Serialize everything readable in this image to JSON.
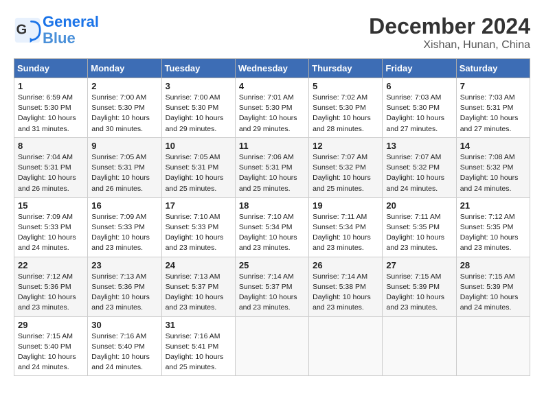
{
  "header": {
    "logo_line1": "General",
    "logo_line2": "Blue",
    "title": "December 2024",
    "location": "Xishan, Hunan, China"
  },
  "days_of_week": [
    "Sunday",
    "Monday",
    "Tuesday",
    "Wednesday",
    "Thursday",
    "Friday",
    "Saturday"
  ],
  "weeks": [
    [
      {
        "day": "1",
        "sunrise": "6:59 AM",
        "sunset": "5:30 PM",
        "daylight": "10 hours and 31 minutes."
      },
      {
        "day": "2",
        "sunrise": "7:00 AM",
        "sunset": "5:30 PM",
        "daylight": "10 hours and 30 minutes."
      },
      {
        "day": "3",
        "sunrise": "7:00 AM",
        "sunset": "5:30 PM",
        "daylight": "10 hours and 29 minutes."
      },
      {
        "day": "4",
        "sunrise": "7:01 AM",
        "sunset": "5:30 PM",
        "daylight": "10 hours and 29 minutes."
      },
      {
        "day": "5",
        "sunrise": "7:02 AM",
        "sunset": "5:30 PM",
        "daylight": "10 hours and 28 minutes."
      },
      {
        "day": "6",
        "sunrise": "7:03 AM",
        "sunset": "5:30 PM",
        "daylight": "10 hours and 27 minutes."
      },
      {
        "day": "7",
        "sunrise": "7:03 AM",
        "sunset": "5:31 PM",
        "daylight": "10 hours and 27 minutes."
      }
    ],
    [
      {
        "day": "8",
        "sunrise": "7:04 AM",
        "sunset": "5:31 PM",
        "daylight": "10 hours and 26 minutes."
      },
      {
        "day": "9",
        "sunrise": "7:05 AM",
        "sunset": "5:31 PM",
        "daylight": "10 hours and 26 minutes."
      },
      {
        "day": "10",
        "sunrise": "7:05 AM",
        "sunset": "5:31 PM",
        "daylight": "10 hours and 25 minutes."
      },
      {
        "day": "11",
        "sunrise": "7:06 AM",
        "sunset": "5:31 PM",
        "daylight": "10 hours and 25 minutes."
      },
      {
        "day": "12",
        "sunrise": "7:07 AM",
        "sunset": "5:32 PM",
        "daylight": "10 hours and 25 minutes."
      },
      {
        "day": "13",
        "sunrise": "7:07 AM",
        "sunset": "5:32 PM",
        "daylight": "10 hours and 24 minutes."
      },
      {
        "day": "14",
        "sunrise": "7:08 AM",
        "sunset": "5:32 PM",
        "daylight": "10 hours and 24 minutes."
      }
    ],
    [
      {
        "day": "15",
        "sunrise": "7:09 AM",
        "sunset": "5:33 PM",
        "daylight": "10 hours and 24 minutes."
      },
      {
        "day": "16",
        "sunrise": "7:09 AM",
        "sunset": "5:33 PM",
        "daylight": "10 hours and 23 minutes."
      },
      {
        "day": "17",
        "sunrise": "7:10 AM",
        "sunset": "5:33 PM",
        "daylight": "10 hours and 23 minutes."
      },
      {
        "day": "18",
        "sunrise": "7:10 AM",
        "sunset": "5:34 PM",
        "daylight": "10 hours and 23 minutes."
      },
      {
        "day": "19",
        "sunrise": "7:11 AM",
        "sunset": "5:34 PM",
        "daylight": "10 hours and 23 minutes."
      },
      {
        "day": "20",
        "sunrise": "7:11 AM",
        "sunset": "5:35 PM",
        "daylight": "10 hours and 23 minutes."
      },
      {
        "day": "21",
        "sunrise": "7:12 AM",
        "sunset": "5:35 PM",
        "daylight": "10 hours and 23 minutes."
      }
    ],
    [
      {
        "day": "22",
        "sunrise": "7:12 AM",
        "sunset": "5:36 PM",
        "daylight": "10 hours and 23 minutes."
      },
      {
        "day": "23",
        "sunrise": "7:13 AM",
        "sunset": "5:36 PM",
        "daylight": "10 hours and 23 minutes."
      },
      {
        "day": "24",
        "sunrise": "7:13 AM",
        "sunset": "5:37 PM",
        "daylight": "10 hours and 23 minutes."
      },
      {
        "day": "25",
        "sunrise": "7:14 AM",
        "sunset": "5:37 PM",
        "daylight": "10 hours and 23 minutes."
      },
      {
        "day": "26",
        "sunrise": "7:14 AM",
        "sunset": "5:38 PM",
        "daylight": "10 hours and 23 minutes."
      },
      {
        "day": "27",
        "sunrise": "7:15 AM",
        "sunset": "5:39 PM",
        "daylight": "10 hours and 23 minutes."
      },
      {
        "day": "28",
        "sunrise": "7:15 AM",
        "sunset": "5:39 PM",
        "daylight": "10 hours and 24 minutes."
      }
    ],
    [
      {
        "day": "29",
        "sunrise": "7:15 AM",
        "sunset": "5:40 PM",
        "daylight": "10 hours and 24 minutes."
      },
      {
        "day": "30",
        "sunrise": "7:16 AM",
        "sunset": "5:40 PM",
        "daylight": "10 hours and 24 minutes."
      },
      {
        "day": "31",
        "sunrise": "7:16 AM",
        "sunset": "5:41 PM",
        "daylight": "10 hours and 25 minutes."
      },
      null,
      null,
      null,
      null
    ]
  ]
}
